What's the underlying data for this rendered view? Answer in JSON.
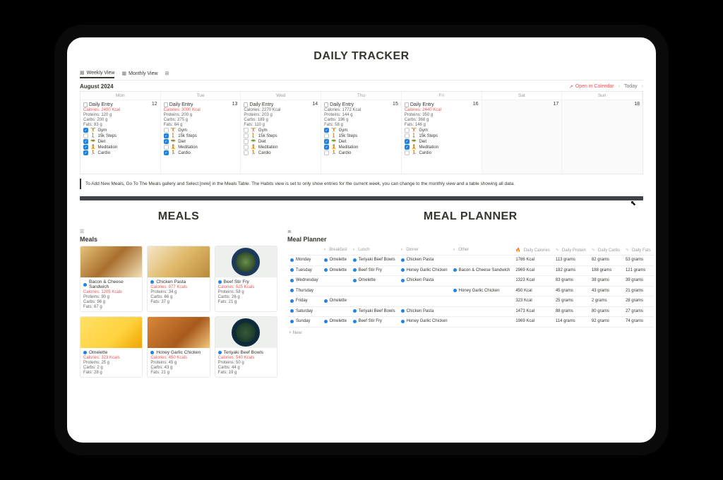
{
  "header": {
    "title": "DAILY TRACKER"
  },
  "views": {
    "weekly": "Weekly View",
    "monthly": "Monthly View"
  },
  "calendar": {
    "month": "August 2024",
    "open_label": "Open in Calendar",
    "today_label": "Today",
    "dow": [
      "Mon",
      "Tue",
      "Wed",
      "Thu",
      "Fri",
      "Sat",
      "Sun"
    ],
    "days": [
      {
        "num": "12",
        "title": "Daily Entry",
        "cals": "Calories: 2400 Kcal",
        "cals_red": true,
        "pro": "Proteins: 120 g",
        "carb": "Carbs: 200 g",
        "fat": "Fats: 83 g",
        "habits": [
          {
            "label": "Gym",
            "emoji": "🏋️",
            "checked": true
          },
          {
            "label": "15k Steps",
            "emoji": "🚶",
            "checked": false
          },
          {
            "label": "Diet",
            "emoji": "🥗",
            "checked": true
          },
          {
            "label": "Meditation",
            "emoji": "🧘",
            "checked": true
          },
          {
            "label": "Cardio",
            "emoji": "🏃",
            "checked": true
          }
        ]
      },
      {
        "num": "13",
        "title": "Daily Entry",
        "cals": "Calories: 3000 Kcal",
        "cals_red": true,
        "pro": "Proteins: 200 g",
        "carb": "Carbs: 275 g",
        "fat": "Fats: 84 g",
        "habits": [
          {
            "label": "Gym",
            "emoji": "🏋️",
            "checked": false
          },
          {
            "label": "15k Steps",
            "emoji": "🚶",
            "checked": true
          },
          {
            "label": "Diet",
            "emoji": "🥗",
            "checked": true
          },
          {
            "label": "Meditation",
            "emoji": "🧘",
            "checked": false
          },
          {
            "label": "Cardio",
            "emoji": "🏃",
            "checked": true
          }
        ]
      },
      {
        "num": "14",
        "title": "Daily Entry",
        "cals": "Calories: 2270 Kcal",
        "cals_red": false,
        "pro": "Proteins: 203 g",
        "carb": "Carbs: 189 g",
        "fat": "Fats: 110 g",
        "habits": [
          {
            "label": "Gym",
            "emoji": "🏋️",
            "checked": false
          },
          {
            "label": "15k Steps",
            "emoji": "🚶",
            "checked": false
          },
          {
            "label": "Diet",
            "emoji": "🥗",
            "checked": false
          },
          {
            "label": "Meditation",
            "emoji": "🧘",
            "checked": false
          },
          {
            "label": "Cardio",
            "emoji": "🏃",
            "checked": false
          }
        ]
      },
      {
        "num": "15",
        "title": "Daily Entry",
        "cals": "Calories: 1772 Kcal",
        "cals_red": false,
        "pro": "Proteins: 144 g",
        "carb": "Carbs: 196 g",
        "fat": "Fats: 58 g",
        "habits": [
          {
            "label": "Gym",
            "emoji": "🏋️",
            "checked": true
          },
          {
            "label": "15k Steps",
            "emoji": "🚶",
            "checked": false
          },
          {
            "label": "Diet",
            "emoji": "🥗",
            "checked": true
          },
          {
            "label": "Meditation",
            "emoji": "🧘",
            "checked": true
          },
          {
            "label": "Cardio",
            "emoji": "🏃",
            "checked": false
          }
        ]
      },
      {
        "num": "16",
        "title": "Daily Entry",
        "cals": "Calories: 2440 Kcal",
        "cals_red": true,
        "pro": "Proteins: 350 g",
        "carb": "Carbs: 368 g",
        "fat": "Fats: 146 g",
        "habits": [
          {
            "label": "Gym",
            "emoji": "🏋️",
            "checked": false
          },
          {
            "label": "15k Steps",
            "emoji": "🚶",
            "checked": false
          },
          {
            "label": "Diet",
            "emoji": "🥗",
            "checked": true
          },
          {
            "label": "Meditation",
            "emoji": "🧘",
            "checked": true
          },
          {
            "label": "Cardio",
            "emoji": "🏃",
            "checked": false
          }
        ]
      }
    ],
    "off": [
      "17",
      "18"
    ]
  },
  "callout": "To Add New Meals, Go To The Meals gallery and Select [new] in the Meals Table. The Habits view is set to only show entries for the current week, you can change to the monthly view and a table showing all data.",
  "meals_section": {
    "title": "MEALS",
    "heading": "Meals"
  },
  "meals": [
    {
      "name": "Bacon & Cheese Sandwich",
      "cals": "Calories: 1205 Kcals",
      "pro": "Proteins: 90 g",
      "carb": "Carbs: 98 g",
      "fat": "Fats: 67 g",
      "img": "sandwich"
    },
    {
      "name": "Chicken Pasta",
      "cals": "Calories: 877 Kcals",
      "pro": "Proteins: 34 g",
      "carb": "Carbs: 66 g",
      "fat": "Fats: 37 g",
      "img": "pasta"
    },
    {
      "name": "Beef Stir Fry",
      "cals": "Calories: 525 Kcals",
      "pro": "Proteins: 58 g",
      "carb": "Carbs: 26 g",
      "fat": "Fats: 21 g",
      "img": "stir"
    },
    {
      "name": "Omelette",
      "cals": "Calories: 323 Kcals",
      "pro": "Proteins: 25 g",
      "carb": "Carbs: 2 g",
      "fat": "Fats: 28 g",
      "img": "omelette"
    },
    {
      "name": "Honey Garlic Chicken",
      "cals": "Calories: 450 Kcals",
      "pro": "Proteins: 45 g",
      "carb": "Carbs: 43 g",
      "fat": "Fats: 21 g",
      "img": "honey"
    },
    {
      "name": "Teriyaki Beef Bowls",
      "cals": "Calories: 540 Kcals",
      "pro": "Proteins: 50 g",
      "carb": "Carbs: 44 g",
      "fat": "Fats: 19 g",
      "img": "teriyaki"
    }
  ],
  "planner_section": {
    "title": "MEAL PLANNER",
    "heading": "Meal Planner",
    "new": "+  New"
  },
  "planner": {
    "cols": [
      "",
      "Breakfast",
      "Lunch",
      "Dinner",
      "Other",
      "Daily Calories",
      "Daily Protein",
      "Daily Carbs",
      "Daily Fats"
    ],
    "rows": [
      {
        "day": "Monday",
        "bf": "Omelette",
        "lu": "Teriyaki Beef Bowls",
        "di": "Chicken Pasta",
        "ot": "",
        "cal": "1786 Kcal",
        "pro": "113 grams",
        "carb": "82 grams",
        "fat": "53 grams"
      },
      {
        "day": "Tuesday",
        "bf": "Omelette",
        "lu": "Beef Stir Fry",
        "di": "Honey Garlic Chicken",
        "ot": "Bacon & Cheese Sandwich",
        "cal": "2969 Kcal",
        "pro": "182 grams",
        "carb": "188 grams",
        "fat": "121 grams"
      },
      {
        "day": "Wednesday",
        "bf": "",
        "lu": "Omelette",
        "di": "Chicken Pasta",
        "ot": "",
        "cal": "1323 Kcal",
        "pro": "83 grams",
        "carb": "38 grams",
        "fat": "39 grams"
      },
      {
        "day": "Thursday",
        "bf": "",
        "lu": "",
        "di": "",
        "ot": "Honey Garlic Chicken",
        "cal": "450 Kcal",
        "pro": "45 grams",
        "carb": "43 grams",
        "fat": "21 grams"
      },
      {
        "day": "Friday",
        "bf": "Omelette",
        "lu": "",
        "di": "",
        "ot": "",
        "cal": "323 Kcal",
        "pro": "25 grams",
        "carb": "2 grams",
        "fat": "28 grams"
      },
      {
        "day": "Saturday",
        "bf": "",
        "lu": "Teriyaki Beef Bowls",
        "di": "Chicken Pasta",
        "ot": "",
        "cal": "1473 Kcal",
        "pro": "88 grams",
        "carb": "80 grams",
        "fat": "27 grams"
      },
      {
        "day": "Sunday",
        "bf": "Omelette",
        "lu": "Beef Stir Fry",
        "di": "Honey Garlic Chicken",
        "ot": "",
        "cal": "1969 Kcal",
        "pro": "114 grams",
        "carb": "92 grams",
        "fat": "74 grams"
      }
    ]
  }
}
